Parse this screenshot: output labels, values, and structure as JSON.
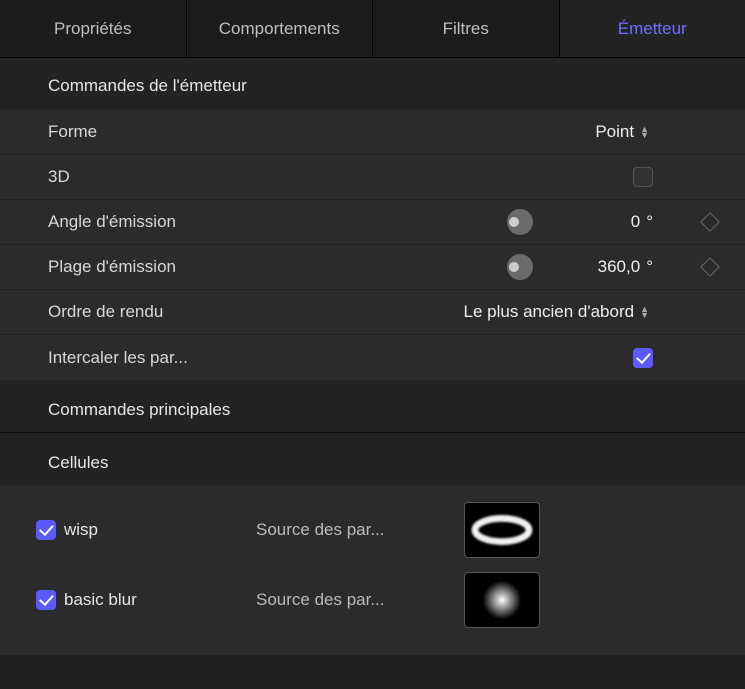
{
  "tabs": {
    "t0": "Propriétés",
    "t1": "Comportements",
    "t2": "Filtres",
    "t3": "Émetteur"
  },
  "sections": {
    "emitter": "Commandes de l'émetteur",
    "main": "Commandes principales",
    "cells": "Cellules"
  },
  "rows": {
    "shape": {
      "label": "Forme",
      "value": "Point"
    },
    "threeD": {
      "label": "3D"
    },
    "emissionAngle": {
      "label": "Angle d'émission",
      "value": "0",
      "unit": "°"
    },
    "emissionRange": {
      "label": "Plage d'émission",
      "value": "360,0",
      "unit": "°"
    },
    "renderOrder": {
      "label": "Ordre de rendu",
      "value": "Le plus ancien d'abord"
    },
    "interleave": {
      "label": "Intercaler les par..."
    }
  },
  "cells": {
    "sourceLabel": "Source des par...",
    "items": [
      {
        "name": "wisp"
      },
      {
        "name": "basic blur"
      }
    ]
  }
}
